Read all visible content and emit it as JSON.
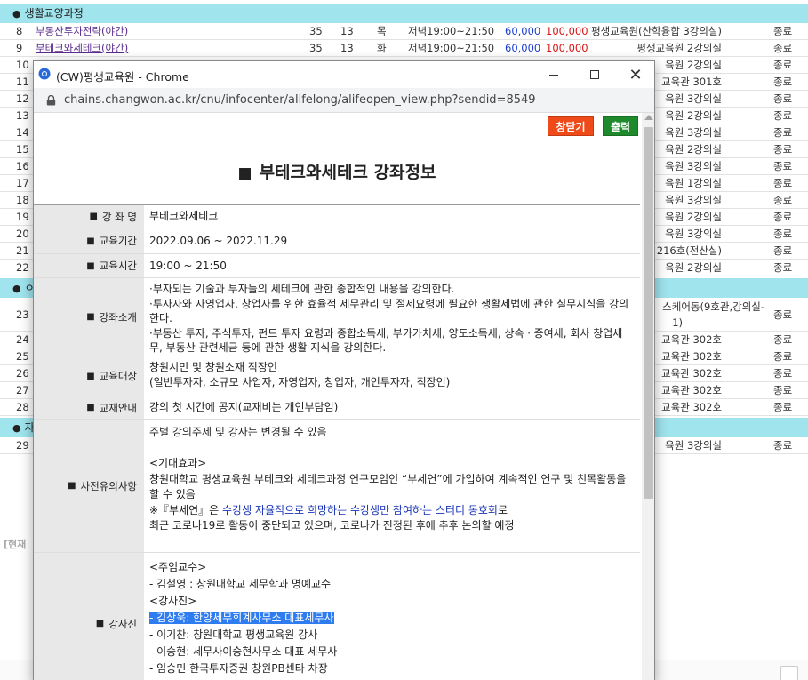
{
  "sections": [
    {
      "label": "생활교양과정"
    },
    {
      "label": "ㅇ"
    },
    {
      "label": "자"
    }
  ],
  "courses": [
    {
      "no": "8",
      "name": "부동산투자전략(야간)",
      "n1": "35",
      "n2": "13",
      "day": "목",
      "time": "저녁19:00~21:50",
      "fee1": "60,000",
      "fee2": "100,000",
      "location": "평생교육원(산학융합 3강의실)",
      "status": "종료"
    },
    {
      "no": "9",
      "name": "부테크와세테크(야간)",
      "n1": "35",
      "n2": "13",
      "day": "화",
      "time": "저녁19:00~21:50",
      "fee1": "60,000",
      "fee2": "100,000",
      "location": "평생교육원 2강의실",
      "status": "종료"
    },
    {
      "no": "10",
      "location": "육원 2강의실",
      "status": "종료"
    },
    {
      "no": "11",
      "location": "교육관 301호",
      "status": "종료"
    },
    {
      "no": "12",
      "location": "육원 3강의실",
      "status": "종료"
    },
    {
      "no": "13",
      "location": "육원 2강의실",
      "status": "종료"
    },
    {
      "no": "14",
      "location": "육원 3강의실",
      "status": "종료"
    },
    {
      "no": "15",
      "location": "육원 2강의실",
      "status": "종료"
    },
    {
      "no": "16",
      "location": "육원 3강의실",
      "status": "종료"
    },
    {
      "no": "17",
      "location": "육원 1강의실",
      "status": "종료"
    },
    {
      "no": "18",
      "location": "육원 3강의실",
      "status": "종료"
    },
    {
      "no": "19",
      "location": "육원 2강의실",
      "status": "종료"
    },
    {
      "no": "20",
      "location": "육원 3강의실",
      "status": "종료"
    },
    {
      "no": "21",
      "location": "원 216호(전산실)",
      "status": "종료"
    },
    {
      "no": "22",
      "location": "육원 2강의실",
      "status": "종료"
    },
    {
      "no": "23",
      "location_line1": "스케어동(9호관,강의실-",
      "location_line2": "1)",
      "status": "종료"
    },
    {
      "no": "24",
      "location": "교육관 302호",
      "status": "종료"
    },
    {
      "no": "25",
      "location": "교육관 302호",
      "status": "종료"
    },
    {
      "no": "26",
      "location": "교육관 302호",
      "status": "종료"
    },
    {
      "no": "27",
      "location": "교육관 302호",
      "status": "종료"
    },
    {
      "no": "28",
      "location": "교육관 302호",
      "status": "종료"
    },
    {
      "no": "29",
      "location": "육원 3강의실",
      "status": "종료"
    }
  ],
  "current_label": "[현재",
  "popup": {
    "window_title": "(CW)평생교육원 - Chrome",
    "url": "chains.changwon.ac.kr/cnu/infocenter/alifelong/alifeopen_view.php?sendid=8549",
    "close_button": "창닫기",
    "print_button": "출력",
    "heading_mark": "■",
    "heading": "부테크와세테크 강좌정보",
    "label_mark": "■",
    "rows": {
      "name": {
        "label": "강 좌 명",
        "value": "부테크와세테크"
      },
      "period": {
        "label": "교육기간",
        "value": "2022.09.06 ~ 2022.11.29"
      },
      "time": {
        "label": "교육시간",
        "value": "19:00 ~ 21:50"
      },
      "intro": {
        "label": "강좌소개",
        "value": "·부자되는 기술과 부자들의 세테크에 관한 종합적인 내용을 강의한다.\n·투자자와 자영업자, 창업자를 위한 효율적 세무관리 및 절세요령에 필요한 생활세법에 관한 실무지식을 강의한다.\n·부동산 투자, 주식투자, 펀드 투자 요령과 종합소득세, 부가가치세, 양도소득세, 상속ㆍ증여세, 회사 창업세무, 부동산 관련세금 등에 관한 생활 지식을 강의한다."
      },
      "target": {
        "label": "교육대상",
        "value": "창원시민 및 창원소재 직장인\n(일반투자자, 소규모 사업자, 자영업자, 창업자, 개인투자자, 직장인)"
      },
      "textbook": {
        "label": "교재안내",
        "value": "강의 첫 시간에 공지(교재비는 개인부담임)"
      },
      "notice": {
        "label": "사전유의사항",
        "line1": "주별 강의주제 및 강사는 변경될 수 있음",
        "line2": "<기대효과>",
        "line3": "창원대학교 평생교육원 부테크와 세테크과정 연구모임인 “부세연”에 가입하여 계속적인 연구 및 친목활동을 할 수 있음",
        "line4_prefix": "※『부세연』은 ",
        "line4_blue": "수강생 자율적으로 희망하는 수강생만 참여하는 스터디 동호회",
        "line4_suffix": "로",
        "line5": "최근 코로나19로 활동이  중단되고 있으며, 코로나가 진정된 후에 추후 논의할 예정"
      },
      "instructors": {
        "label": "강사진",
        "line1": "<주임교수>",
        "line2": "- 김철영 : 창원대학교 세무학과 명예교수",
        "line3": "<강사진>",
        "line4": "- 김상욱: 한양세무회계사무소 대표세무사",
        "line5": "- 이기찬: 창원대학교 평생교육원 강사",
        "line6": "- 이승현: 세무사이승현사무소  대표 세무사",
        "line7": "- 임승민  한국투자증권 창원PB센타 차장"
      }
    }
  },
  "colors": {
    "section_bg": "#a0e4ee",
    "fee_blue": "#1a3fd0",
    "fee_red": "#d91414",
    "close_btn": "#ef4a1a",
    "print_btn": "#1e8a2c",
    "highlight": "#2e7cf0"
  }
}
